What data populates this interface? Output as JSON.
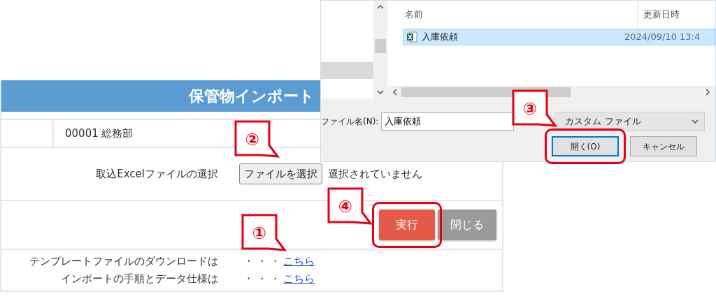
{
  "page": {
    "title": "保管物インポート",
    "department": "00001 総務部",
    "file_label": "取込Excelファイルの選択",
    "file_button": "ファイルを選択",
    "file_status": "選択されていません",
    "actions": [
      {
        "label": "実行",
        "kind": "primary",
        "highlighted": true
      },
      {
        "label": "閉じる",
        "kind": "secondary",
        "highlighted": false
      }
    ],
    "links": [
      {
        "label": "テンプレートファイルのダウンロードは",
        "leader": "・・・",
        "link": "こちら"
      },
      {
        "label": "インポートの手順とデータ仕様は",
        "leader": "・・・",
        "link": "こちら"
      }
    ]
  },
  "dialog": {
    "columns": [
      "名前",
      "更新日時"
    ],
    "files": [
      {
        "name": "入庫依頼",
        "modified": "2024/09/10 13:4",
        "selected": true
      }
    ],
    "filename_label": "ファイル名(N):",
    "filename_value": "入庫依頼",
    "filter": "カスタム ファイル",
    "buttons": [
      {
        "label": "開く(O)",
        "highlighted": true
      },
      {
        "label": "キャンセル",
        "highlighted": false
      }
    ]
  },
  "callouts": [
    {
      "number": "①"
    },
    {
      "number": "②"
    },
    {
      "number": "③"
    },
    {
      "number": "④"
    }
  ]
}
